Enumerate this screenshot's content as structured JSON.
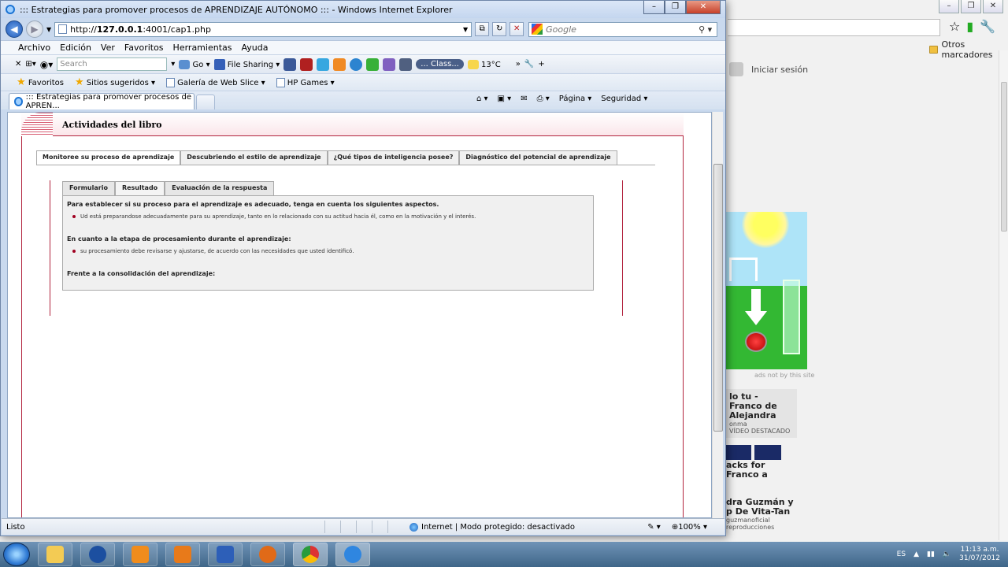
{
  "bg_browser": {
    "bookmark_folder": "Otros marcadores",
    "signin_label": "Iniciar sesión",
    "ad_caption": "ads not by this site",
    "video1": {
      "title": "lo tu - Franco de Alejandra",
      "channel": "onma",
      "tag": "VÍDEO DESTACADO"
    },
    "video2": {
      "title": "acks for Franco a"
    },
    "video3": {
      "title": "dra Guzmán y p De Vita-Tan",
      "channel": "guzmanoficial",
      "views": "reproducciones"
    }
  },
  "ie": {
    "window_title": "::: Estrategias para promover procesos de APRENDIZAJE AUTÓNOMO ::: - Windows Internet Explorer",
    "url_prefix": "http://",
    "url_host": "127.0.0.1",
    "url_rest": ":4001/cap1.php",
    "search_provider": "Google",
    "menu": [
      "Archivo",
      "Edición",
      "Ver",
      "Favoritos",
      "Herramientas",
      "Ayuda"
    ],
    "toolbar": {
      "search_placeholder": "Search",
      "go": "Go",
      "file_sharing": "File Sharing",
      "class_label": "... Class...",
      "temperature": "13°C"
    },
    "favorites": {
      "favoritos": "Favoritos",
      "sitios": "Sitios sugeridos ▾",
      "galeria": "Galería de Web Slice ▾",
      "hp": "HP Games ▾"
    },
    "tab_title": "::: Estrategias para promover procesos de APREN...",
    "cmd": {
      "pagina": "Página ▾",
      "seguridad": "Seguridad ▾"
    },
    "status": {
      "text": "Listo",
      "zone": "Internet | Modo protegido: desactivado",
      "zoom": "100%"
    }
  },
  "page": {
    "section_title": "Actividades del libro",
    "main_tabs": [
      "Monitoree su proceso de aprendizaje",
      "Descubriendo el estilo de aprendizaje",
      "¿Qué tipos de inteligencia posee?",
      "Diagnóstico del potencial de aprendizaje"
    ],
    "sub_tabs": [
      "Formulario",
      "Resultado",
      "Evaluación de la respuesta"
    ],
    "result": {
      "h1": "Para establecer si su proceso para el aprendizaje es adecuado, tenga en cuenta los siguientes aspectos.",
      "li1": "Ud está preparandose adecuadamente para su aprendizaje, tanto en lo relacionado con su actitud hacia él, como en la motivación y el interés.",
      "h2": "En cuanto a la etapa de procesamiento durante el aprendizaje:",
      "li2": "su procesamiento debe revisarse y ajustarse, de acuerdo con las necesidades que usted identificó.",
      "h3": "Frente a la consolidación del aprendizaje:"
    }
  },
  "taskbar": {
    "lang": "ES",
    "time": "11:13 a.m.",
    "date": "31/07/2012"
  }
}
